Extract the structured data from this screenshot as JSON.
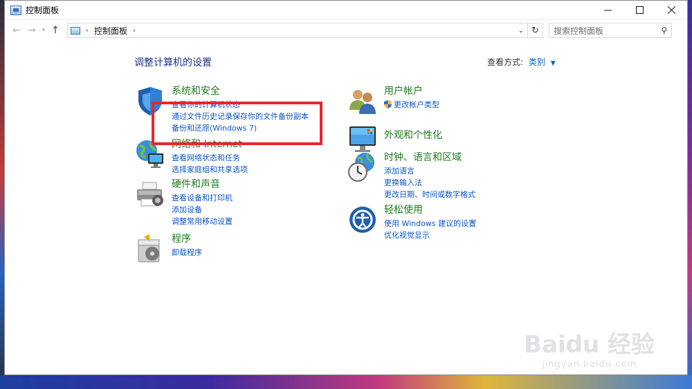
{
  "window": {
    "title": "控制面板"
  },
  "address": {
    "path": "控制面板",
    "separator": "›",
    "search_placeholder": "搜索控制面板"
  },
  "main": {
    "heading": "调整计算机的设置",
    "view_label": "查看方式:",
    "view_value": "类别"
  },
  "categories": {
    "system": {
      "title": "系统和安全",
      "links": [
        "查看你的计算机状态",
        "通过文件历史记录保存你的文件备份副本",
        "备份和还原(Windows 7)"
      ]
    },
    "network": {
      "title": "网络和 Internet",
      "links": [
        "查看网络状态和任务",
        "选择家庭组和共享选项"
      ]
    },
    "hardware": {
      "title": "硬件和声音",
      "links": [
        "查看设备和打印机",
        "添加设备",
        "调整常用移动设置"
      ]
    },
    "programs": {
      "title": "程序",
      "links": [
        "卸载程序"
      ]
    },
    "users": {
      "title": "用户帐户",
      "links": [
        "更改帐户类型"
      ]
    },
    "appearance": {
      "title": "外观和个性化",
      "links": []
    },
    "clock": {
      "title": "时钟、语言和区域",
      "links": [
        "添加语言",
        "更换输入法",
        "更改日期、时间或数字格式"
      ]
    },
    "ease": {
      "title": "轻松使用",
      "links": [
        "使用 Windows 建议的设置",
        "优化视觉显示"
      ]
    }
  },
  "watermark": {
    "main": "Baidu 经验",
    "sub": "jingyan.baidu.com"
  },
  "colors": {
    "category_title": "#1e7a1e",
    "link": "#0b55c4",
    "heading": "#1e3287",
    "highlight_box": "#e8262c"
  }
}
